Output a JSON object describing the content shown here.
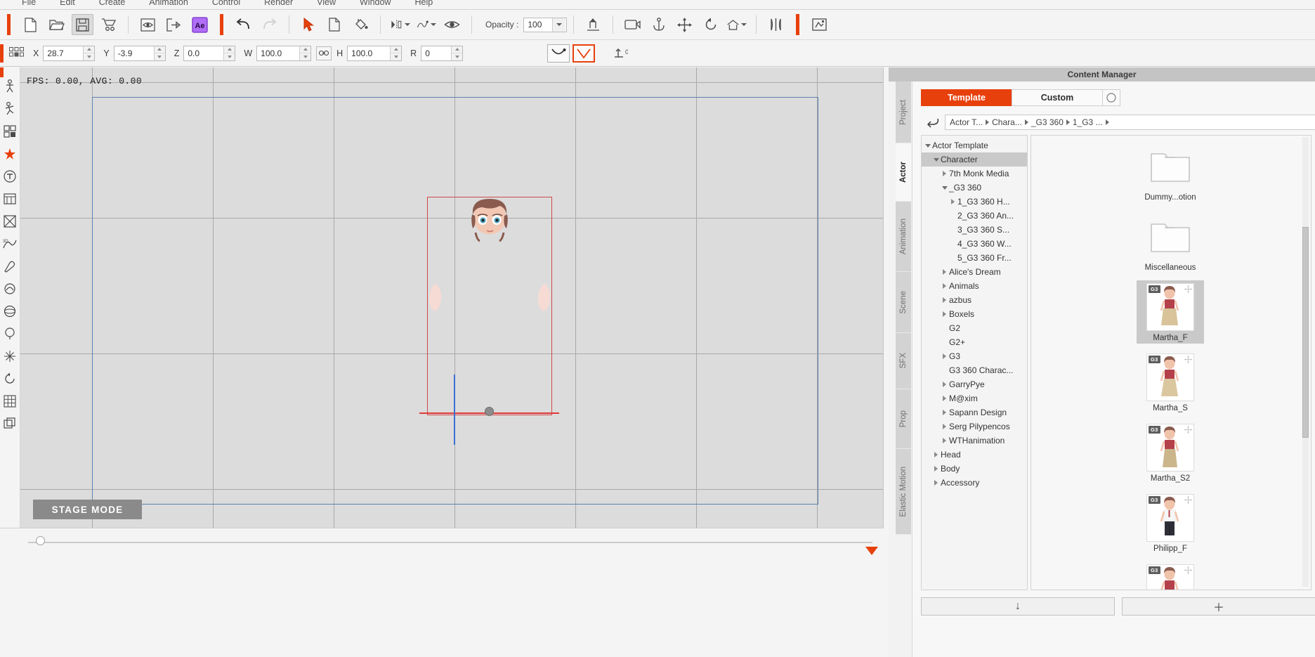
{
  "menu": {
    "items": [
      "File",
      "Edit",
      "Create",
      "Animation",
      "Control",
      "Render",
      "View",
      "Window",
      "Help"
    ]
  },
  "toolbar": {
    "new_label": "new-project",
    "open_label": "open-project",
    "save_label": "save-project",
    "cart_label": "marketplace",
    "preview_label": "preview",
    "export_label": "export",
    "ae_label": "Ae",
    "undo_label": "undo",
    "redo_label": "redo",
    "select_label": "select-tool",
    "transform_label": "transform-tool",
    "path_label": "path-tool",
    "eye_label": "visibility",
    "opacity_label": "Opacity :",
    "opacity_value": "100",
    "align_label": "align",
    "camera_label": "camera",
    "anchor_label": "anchor",
    "move_label": "move",
    "rotate_label": "rotate",
    "home_label": "home",
    "mirror_label": "mirror",
    "render_label": "render-preview"
  },
  "transform": {
    "x_label": "X",
    "x_value": "28.7",
    "y_label": "Y",
    "y_value": "-3.9",
    "z_label": "Z",
    "z_value": "0.0",
    "w_label": "W",
    "w_value": "100.0",
    "h_label": "H",
    "h_value": "100.0",
    "r_label": "R",
    "r_value": "0",
    "link_label": "link-aspect-ratio",
    "smile_label": "smile-curve",
    "check_label": "check-curve",
    "baseline_label": "baseline-0"
  },
  "viewport": {
    "fps_text": "FPS: 0.00, AVG: 0.00",
    "stage_mode": "STAGE MODE"
  },
  "content_manager": {
    "title": "Content Manager",
    "tabs": [
      {
        "label": "Template",
        "active": true
      },
      {
        "label": "Custom",
        "active": false
      }
    ],
    "back_label": "back",
    "breadcrumbs": [
      "Actor T...",
      "Chara...",
      "_G3 360",
      "1_G3 ..."
    ],
    "tree": [
      {
        "label": "Actor Template",
        "indent": 0,
        "twisty": "down",
        "selected": false
      },
      {
        "label": "Character",
        "indent": 1,
        "twisty": "down",
        "selected": true
      },
      {
        "label": "7th Monk Media",
        "indent": 2,
        "twisty": "right",
        "selected": false
      },
      {
        "label": "_G3 360",
        "indent": 2,
        "twisty": "down",
        "selected": false
      },
      {
        "label": "1_G3 360 H...",
        "indent": 3,
        "twisty": "right",
        "selected": false
      },
      {
        "label": "2_G3 360 An...",
        "indent": 3,
        "twisty": "none",
        "selected": false
      },
      {
        "label": "3_G3 360 S...",
        "indent": 3,
        "twisty": "none",
        "selected": false
      },
      {
        "label": "4_G3 360 W...",
        "indent": 3,
        "twisty": "none",
        "selected": false
      },
      {
        "label": "5_G3 360 Fr...",
        "indent": 3,
        "twisty": "none",
        "selected": false
      },
      {
        "label": "Alice's Dream",
        "indent": 2,
        "twisty": "right",
        "selected": false
      },
      {
        "label": "Animals",
        "indent": 2,
        "twisty": "right",
        "selected": false
      },
      {
        "label": "azbus",
        "indent": 2,
        "twisty": "right",
        "selected": false
      },
      {
        "label": "Boxels",
        "indent": 2,
        "twisty": "right",
        "selected": false
      },
      {
        "label": "G2",
        "indent": 2,
        "twisty": "none",
        "selected": false
      },
      {
        "label": "G2+",
        "indent": 2,
        "twisty": "none",
        "selected": false
      },
      {
        "label": "G3",
        "indent": 2,
        "twisty": "right",
        "selected": false
      },
      {
        "label": "G3 360 Charac...",
        "indent": 2,
        "twisty": "none",
        "selected": false
      },
      {
        "label": "GarryPye",
        "indent": 2,
        "twisty": "right",
        "selected": false
      },
      {
        "label": "M@xim",
        "indent": 2,
        "twisty": "right",
        "selected": false
      },
      {
        "label": "Sapann Design",
        "indent": 2,
        "twisty": "right",
        "selected": false
      },
      {
        "label": "Serg Pilypencos",
        "indent": 2,
        "twisty": "right",
        "selected": false
      },
      {
        "label": "WTHanimation",
        "indent": 2,
        "twisty": "right",
        "selected": false
      },
      {
        "label": "Head",
        "indent": 1,
        "twisty": "right",
        "selected": false
      },
      {
        "label": "Body",
        "indent": 1,
        "twisty": "right",
        "selected": false
      },
      {
        "label": "Accessory",
        "indent": 1,
        "twisty": "right",
        "selected": false
      }
    ],
    "thumbnails": [
      {
        "label": "Dummy...otion",
        "kind": "folder",
        "badge": "",
        "selected": false
      },
      {
        "label": "Miscellaneous",
        "kind": "folder",
        "badge": "",
        "selected": false
      },
      {
        "label": "Martha_F",
        "kind": "character",
        "badge": "G3",
        "selected": true,
        "variant": "female-pants"
      },
      {
        "label": "Martha_S",
        "kind": "character",
        "badge": "G3",
        "selected": false,
        "variant": "female-skirt"
      },
      {
        "label": "Martha_S2",
        "kind": "character",
        "badge": "G3",
        "selected": false,
        "variant": "female-skirt2"
      },
      {
        "label": "Philipp_F",
        "kind": "character",
        "badge": "G3",
        "selected": false,
        "variant": "male"
      },
      {
        "label": "",
        "kind": "character",
        "badge": "G3",
        "selected": false,
        "variant": "female-partial"
      }
    ],
    "bottom_buttons": [
      {
        "label": "↓",
        "name": "download-button"
      },
      {
        "label": "＋",
        "name": "add-button"
      }
    ]
  },
  "side_tabs": [
    {
      "label": "Project",
      "active": false
    },
    {
      "label": "Actor",
      "active": true
    },
    {
      "label": "Animation",
      "active": false
    },
    {
      "label": "Scene",
      "active": false
    },
    {
      "label": "SFX",
      "active": false
    },
    {
      "label": "Prop",
      "active": false
    },
    {
      "label": "Elastic Motion",
      "active": false
    }
  ],
  "colors": {
    "accent": "#e8400c",
    "stage_bg": "#dcdcdc",
    "panel_bg": "#f4f4f4",
    "frame_blue": "#5b83b0",
    "frame_red": "#d0474a"
  }
}
